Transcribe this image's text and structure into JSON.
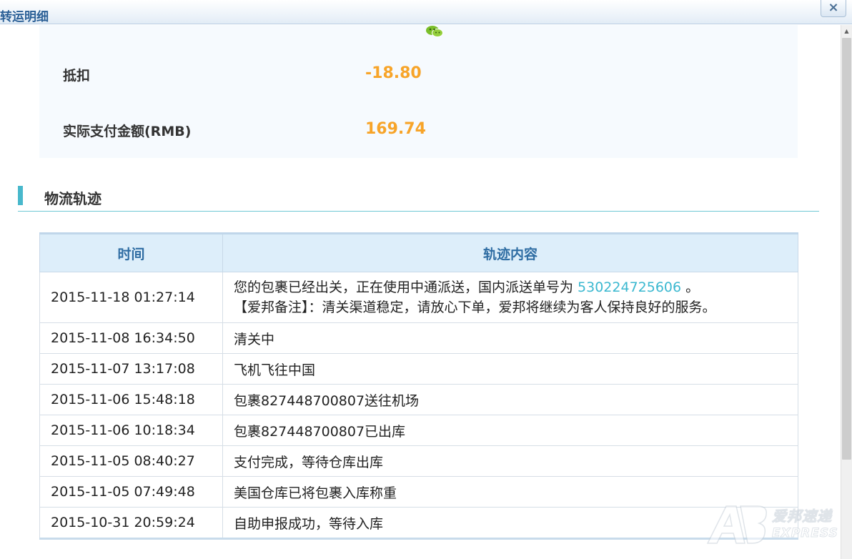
{
  "dialog": {
    "title": "转运明细",
    "close_symbol": "×"
  },
  "summary": {
    "rows": [
      {
        "label": "抵扣",
        "value": "-18.80"
      },
      {
        "label": "实际支付金额(RMB)",
        "value": "169.74"
      }
    ]
  },
  "logistics": {
    "section_title": "物流轨迹",
    "headers": [
      "时间",
      "轨迹内容"
    ],
    "tracking_number": "530224725606",
    "rows": [
      {
        "time": "2015-11-18 01:27:14",
        "content_prefix": "您的包裹已经出关，正在使用中通派送，国内派送单号为 ",
        "content_suffix": " 。",
        "content_line2": "【爱邦备注】：清关渠道稳定，请放心下单，爱邦将继续为客人保持良好的服务。"
      },
      {
        "time": "2015-11-08 16:34:50",
        "content": "清关中"
      },
      {
        "time": "2015-11-07 13:17:08",
        "content": "飞机飞往中国"
      },
      {
        "time": "2015-11-06 15:48:18",
        "content": "包裹827448700807送往机场"
      },
      {
        "time": "2015-11-06 10:18:34",
        "content": "包裹827448700807已出库"
      },
      {
        "time": "2015-11-05 08:40:27",
        "content": "支付完成，等待仓库出库"
      },
      {
        "time": "2015-11-05 07:49:48",
        "content": "美国仓库已将包裹入库称重"
      },
      {
        "time": "2015-10-31 20:59:24",
        "content": "自助申报成功，等待入库"
      }
    ]
  },
  "watermark": {
    "brand": "爱邦速递",
    "sub": "EXPRESS"
  },
  "colors": {
    "accent_orange": "#f7a429",
    "title_blue": "#2a5f96",
    "header_blue": "#2f6da3",
    "section_teal": "#48b8cc",
    "link_teal": "#3bb8d0"
  },
  "icons": {
    "chat": "wechat-icon",
    "close": "close-icon",
    "watermark_logo": "ab-logo-icon"
  }
}
